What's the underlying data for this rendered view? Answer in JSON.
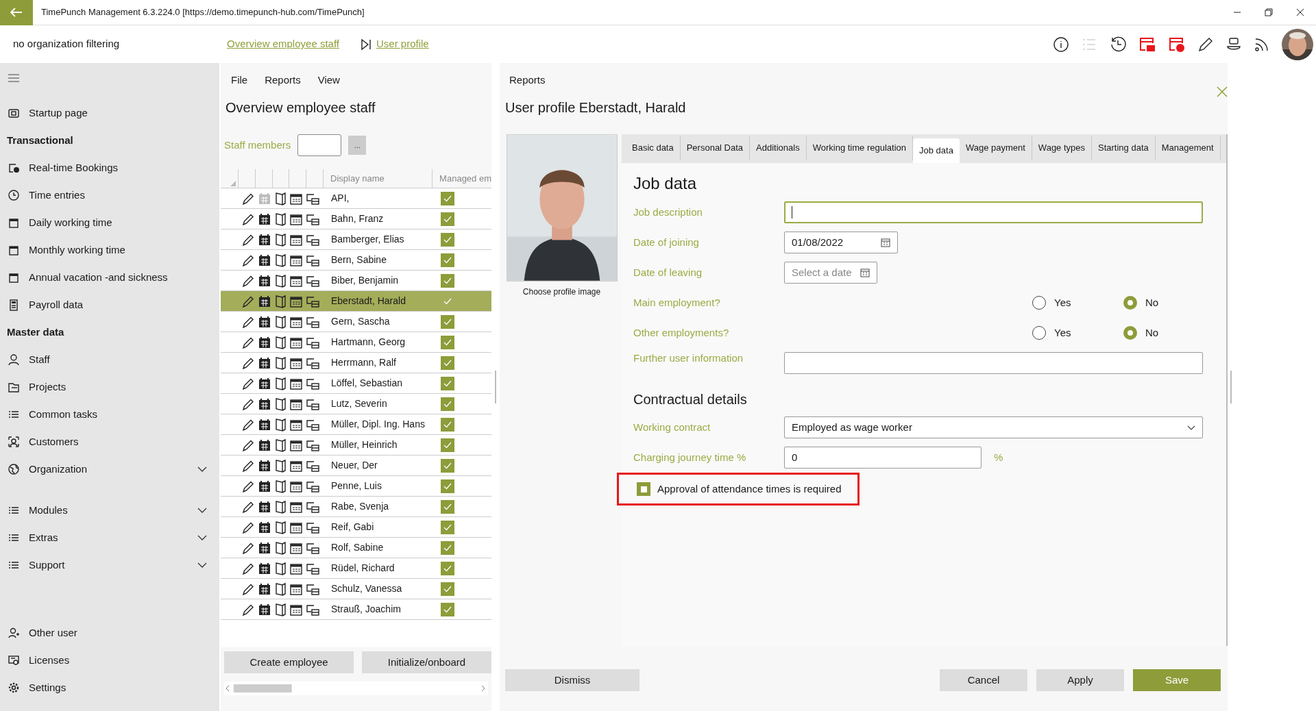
{
  "window": {
    "title": "TimePunch Management 6.3.224.0 [https://demo.timepunch-hub.com/TimePunch]"
  },
  "header": {
    "filter": "no organization filtering",
    "breadcrumbs": [
      "Overview employee staff",
      "User profile"
    ]
  },
  "sidebar": {
    "items": [
      {
        "kind": "item",
        "label": "Startup page"
      },
      {
        "kind": "heading",
        "label": "Transactional"
      },
      {
        "kind": "item",
        "label": "Real-time Bookings"
      },
      {
        "kind": "item",
        "label": "Time entries"
      },
      {
        "kind": "item",
        "label": "Daily working time"
      },
      {
        "kind": "item",
        "label": "Monthly working time"
      },
      {
        "kind": "item",
        "label": "Annual vacation -and sickness"
      },
      {
        "kind": "item",
        "label": "Payroll data"
      },
      {
        "kind": "heading",
        "label": "Master data"
      },
      {
        "kind": "item",
        "label": "Staff"
      },
      {
        "kind": "item",
        "label": "Projects"
      },
      {
        "kind": "item",
        "label": "Common tasks"
      },
      {
        "kind": "item",
        "label": "Customers"
      },
      {
        "kind": "group",
        "label": "Organization",
        "expanded": false
      },
      {
        "kind": "gap"
      },
      {
        "kind": "group",
        "label": "Modules",
        "expanded": false
      },
      {
        "kind": "group",
        "label": "Extras",
        "expanded": false
      },
      {
        "kind": "group",
        "label": "Support",
        "expanded": false
      }
    ],
    "bottom": [
      "Other user",
      "Licenses",
      "Settings"
    ]
  },
  "staff_panel": {
    "menu": [
      "File",
      "Reports",
      "View"
    ],
    "title": "Overview employee staff",
    "filter_label": "Staff members",
    "more_button": "...",
    "columns": [
      "Display name",
      "Managed em"
    ],
    "rows": [
      {
        "name": "API,",
        "calendar_enabled": false,
        "managed": true,
        "selected": false
      },
      {
        "name": "Bahn, Franz",
        "calendar_enabled": true,
        "managed": true,
        "selected": false
      },
      {
        "name": "Bamberger, Elias",
        "calendar_enabled": true,
        "managed": true,
        "selected": false
      },
      {
        "name": "Bern, Sabine",
        "calendar_enabled": true,
        "managed": true,
        "selected": false
      },
      {
        "name": "Biber, Benjamin",
        "calendar_enabled": true,
        "managed": true,
        "selected": false
      },
      {
        "name": "Eberstadt, Harald",
        "calendar_enabled": true,
        "managed": true,
        "selected": true
      },
      {
        "name": "Gern, Sascha",
        "calendar_enabled": true,
        "managed": true,
        "selected": false
      },
      {
        "name": "Hartmann, Georg",
        "calendar_enabled": true,
        "managed": true,
        "selected": false
      },
      {
        "name": "Herrmann, Ralf",
        "calendar_enabled": true,
        "managed": true,
        "selected": false
      },
      {
        "name": "Löffel, Sebastian",
        "calendar_enabled": true,
        "managed": true,
        "selected": false
      },
      {
        "name": "Lutz, Severin",
        "calendar_enabled": true,
        "managed": true,
        "selected": false
      },
      {
        "name": "Müller, Dipl. Ing. Hans",
        "calendar_enabled": true,
        "managed": true,
        "selected": false
      },
      {
        "name": "Müller, Heinrich",
        "calendar_enabled": true,
        "managed": true,
        "selected": false
      },
      {
        "name": "Neuer, Der",
        "calendar_enabled": true,
        "managed": true,
        "selected": false
      },
      {
        "name": "Penne, Luis",
        "calendar_enabled": true,
        "managed": true,
        "selected": false
      },
      {
        "name": "Rabe, Svenja",
        "calendar_enabled": true,
        "managed": true,
        "selected": false
      },
      {
        "name": "Reif, Gabi",
        "calendar_enabled": true,
        "managed": true,
        "selected": false
      },
      {
        "name": "Rolf, Sabine",
        "calendar_enabled": true,
        "managed": true,
        "selected": false
      },
      {
        "name": "Rüdel, Richard",
        "calendar_enabled": true,
        "managed": true,
        "selected": false
      },
      {
        "name": "Schulz, Vanessa",
        "calendar_enabled": true,
        "managed": true,
        "selected": false
      },
      {
        "name": "Strauß, Joachim",
        "calendar_enabled": true,
        "managed": true,
        "selected": false
      }
    ],
    "buttons": [
      "Create employee",
      "Initialize/onboard"
    ]
  },
  "profile": {
    "menu": "Reports",
    "title": "User profile Eberstadt, Harald",
    "photo_caption": "Choose profile image",
    "tabs": [
      {
        "label": "Basic data",
        "selected": false
      },
      {
        "label": "Personal Data",
        "selected": false
      },
      {
        "label": "Additionals",
        "selected": false
      },
      {
        "label": "Working time regulation",
        "selected": false
      },
      {
        "label": "Job data",
        "selected": true
      },
      {
        "label": "Wage payment",
        "selected": false
      },
      {
        "label": "Wage types",
        "selected": false
      },
      {
        "label": "Starting data",
        "selected": false
      },
      {
        "label": "Management",
        "selected": false
      }
    ],
    "heading": "Job data",
    "fields": [
      {
        "kind": "text",
        "label": "Job description",
        "focused": true
      },
      {
        "kind": "date",
        "label": "Date of joining",
        "value": "01/08/2022"
      },
      {
        "kind": "date",
        "label": "Date of leaving",
        "placeholder": "Select a date"
      },
      {
        "kind": "radio",
        "label": "Main employment?",
        "options": [
          {
            "label": "Yes",
            "selected": false
          },
          {
            "label": "No",
            "selected": true
          }
        ]
      },
      {
        "kind": "radio",
        "label": "Other employments?",
        "options": [
          {
            "label": "Yes",
            "selected": false
          },
          {
            "label": "No",
            "selected": true
          }
        ]
      },
      {
        "kind": "text",
        "label": "Further user information",
        "focused": false
      }
    ],
    "contract_heading": "Contractual details",
    "contract_fields": [
      {
        "kind": "select",
        "label": "Working contract",
        "value": "Employed as wage worker"
      },
      {
        "kind": "number",
        "label": "Charging journey time %",
        "value": "0",
        "unit": "%"
      }
    ],
    "approval": {
      "label": "Approval of attendance times is required",
      "checked": true,
      "highlighted": true
    },
    "buttons": {
      "dismiss": "Dismiss",
      "cancel": "Cancel",
      "apply": "Apply",
      "save": "Save"
    }
  }
}
